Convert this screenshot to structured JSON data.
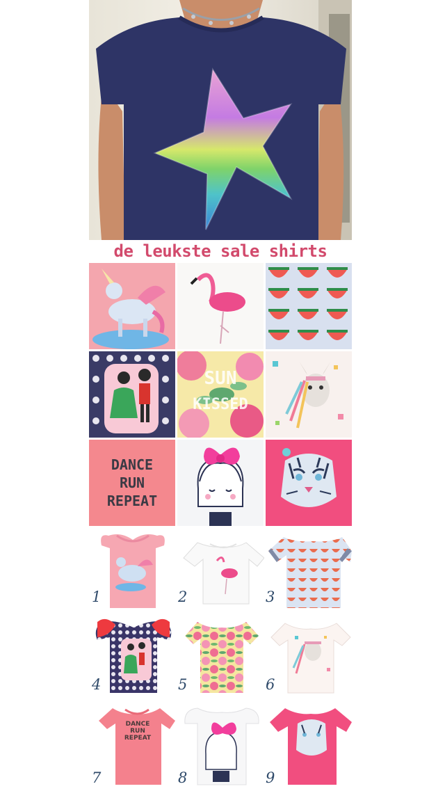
{
  "title": "de leukste sale shirts",
  "tiles": {
    "dance_line1": "DANCE",
    "dance_line2": "RUN",
    "dance_line3": "REPEAT",
    "sunkissed_1": "SUN",
    "sunkissed_2": "KISSED"
  },
  "products": [
    {
      "number": "1"
    },
    {
      "number": "2"
    },
    {
      "number": "3"
    },
    {
      "number": "4"
    },
    {
      "number": "5"
    },
    {
      "number": "6"
    },
    {
      "number": "7",
      "text_1": "DANCE",
      "text_2": "RUN",
      "text_3": "REPEAT"
    },
    {
      "number": "8"
    },
    {
      "number": "9"
    }
  ]
}
